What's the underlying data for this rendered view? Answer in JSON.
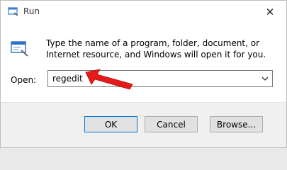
{
  "window": {
    "title": "Run",
    "close_glyph": "✕"
  },
  "dialog": {
    "description": "Type the name of a program, folder, document, or Internet resource, and Windows will open it for you.",
    "open_label": "Open:",
    "open_value": "regedit"
  },
  "buttons": {
    "ok": "OK",
    "cancel": "Cancel",
    "browse": "Browse..."
  },
  "icons": {
    "title": "run-icon",
    "app": "run-app-icon",
    "dropdown": "chevron-down-icon",
    "annotation": "red-arrow-icon"
  },
  "colors": {
    "accent": "#0078d7",
    "arrow": "#e31b1b"
  }
}
